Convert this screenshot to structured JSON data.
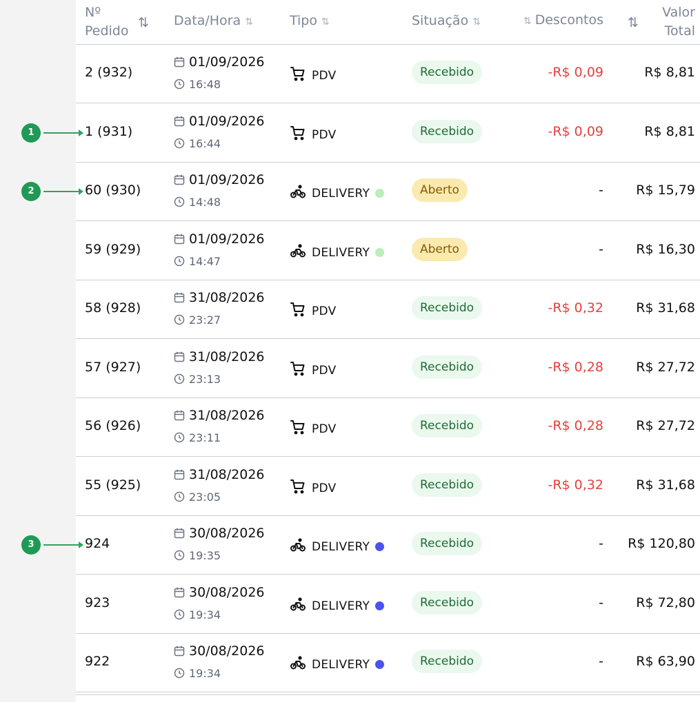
{
  "header": {
    "pedido_line1": "Nº",
    "pedido_line2": "Pedido",
    "datahora": "Data/Hora",
    "tipo": "Tipo",
    "situacao": "Situação",
    "descontos": "Descontos",
    "valor_line1": "Valor",
    "valor_line2": "Total",
    "sort_glyph": "⇅"
  },
  "colors": {
    "recebido_bg": "#eaf8ee",
    "recebido_fg": "#1f6b35",
    "aberto_bg": "#fbeab0",
    "aberto_fg": "#8a5a00",
    "discount": "#e5413b",
    "dot_green": "#b9efb8",
    "dot_blue": "#4c52f0"
  },
  "rows": [
    {
      "pedido": "2 (932)",
      "date": "01/09/2026",
      "time": "16:48",
      "tipo": "PDV",
      "icon": "cart-icon",
      "dot": "",
      "situacao": "Recebido",
      "status": "recebido",
      "desconto": "-R$ 0,09",
      "valor": "R$ 8,81"
    },
    {
      "pedido": "1 (931)",
      "date": "01/09/2026",
      "time": "16:44",
      "tipo": "PDV",
      "icon": "cart-icon",
      "dot": "",
      "situacao": "Recebido",
      "status": "recebido",
      "desconto": "-R$ 0,09",
      "valor": "R$ 8,81"
    },
    {
      "pedido": "60 (930)",
      "date": "01/09/2026",
      "time": "14:48",
      "tipo": "DELIVERY",
      "icon": "bike-icon",
      "dot": "green",
      "situacao": "Aberto",
      "status": "aberto",
      "desconto": "-",
      "valor": "R$ 15,79"
    },
    {
      "pedido": "59 (929)",
      "date": "01/09/2026",
      "time": "14:47",
      "tipo": "DELIVERY",
      "icon": "bike-icon",
      "dot": "green",
      "situacao": "Aberto",
      "status": "aberto",
      "desconto": "-",
      "valor": "R$ 16,30"
    },
    {
      "pedido": "58 (928)",
      "date": "31/08/2026",
      "time": "23:27",
      "tipo": "PDV",
      "icon": "cart-icon",
      "dot": "",
      "situacao": "Recebido",
      "status": "recebido",
      "desconto": "-R$ 0,32",
      "valor": "R$ 31,68"
    },
    {
      "pedido": "57 (927)",
      "date": "31/08/2026",
      "time": "23:13",
      "tipo": "PDV",
      "icon": "cart-icon",
      "dot": "",
      "situacao": "Recebido",
      "status": "recebido",
      "desconto": "-R$ 0,28",
      "valor": "R$ 27,72"
    },
    {
      "pedido": "56 (926)",
      "date": "31/08/2026",
      "time": "23:11",
      "tipo": "PDV",
      "icon": "cart-icon",
      "dot": "",
      "situacao": "Recebido",
      "status": "recebido",
      "desconto": "-R$ 0,28",
      "valor": "R$ 27,72"
    },
    {
      "pedido": "55 (925)",
      "date": "31/08/2026",
      "time": "23:05",
      "tipo": "PDV",
      "icon": "cart-icon",
      "dot": "",
      "situacao": "Recebido",
      "status": "recebido",
      "desconto": "-R$ 0,32",
      "valor": "R$ 31,68"
    },
    {
      "pedido": "924",
      "date": "30/08/2026",
      "time": "19:35",
      "tipo": "DELIVERY",
      "icon": "bike-icon",
      "dot": "blue",
      "situacao": "Recebido",
      "status": "recebido",
      "desconto": "-",
      "valor": "R$ 120,80"
    },
    {
      "pedido": "923",
      "date": "30/08/2026",
      "time": "19:34",
      "tipo": "DELIVERY",
      "icon": "bike-icon",
      "dot": "blue",
      "situacao": "Recebido",
      "status": "recebido",
      "desconto": "-",
      "valor": "R$ 72,80"
    },
    {
      "pedido": "922",
      "date": "30/08/2026",
      "time": "19:34",
      "tipo": "DELIVERY",
      "icon": "bike-icon",
      "dot": "blue",
      "situacao": "Recebido",
      "status": "recebido",
      "desconto": "-",
      "valor": "R$ 63,90"
    }
  ],
  "annotations": [
    {
      "label": "1",
      "row": 1
    },
    {
      "label": "2",
      "row": 2
    },
    {
      "label": "3",
      "row": 8
    }
  ]
}
